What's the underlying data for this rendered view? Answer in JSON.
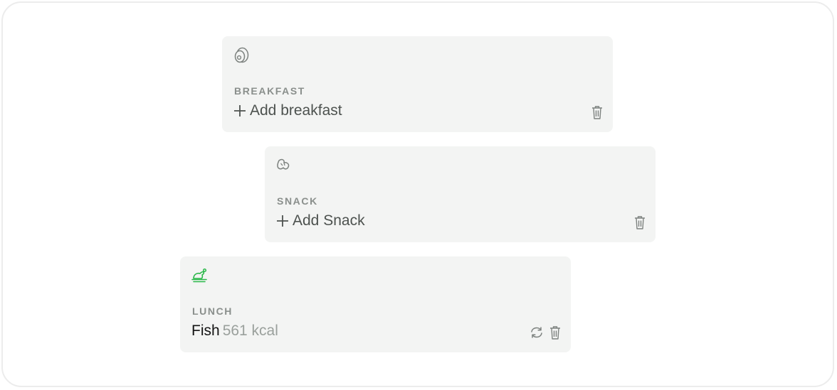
{
  "meals": {
    "breakfast": {
      "label": "BREAKFAST",
      "add_label": "Add breakfast",
      "icon": "egg-icon"
    },
    "snack": {
      "label": "SNACK",
      "add_label": "Add Snack",
      "icon": "croissant-icon"
    },
    "lunch": {
      "label": "LUNCH",
      "food_name": "Fish",
      "food_kcal": "561 kcal",
      "icon": "roast-chicken-icon",
      "icon_color": "#2bb84a"
    }
  },
  "colors": {
    "card_bg": "#f3f4f3",
    "label": "#8a8f8c",
    "muted": "#9aa09c",
    "accent": "#2bb84a"
  }
}
